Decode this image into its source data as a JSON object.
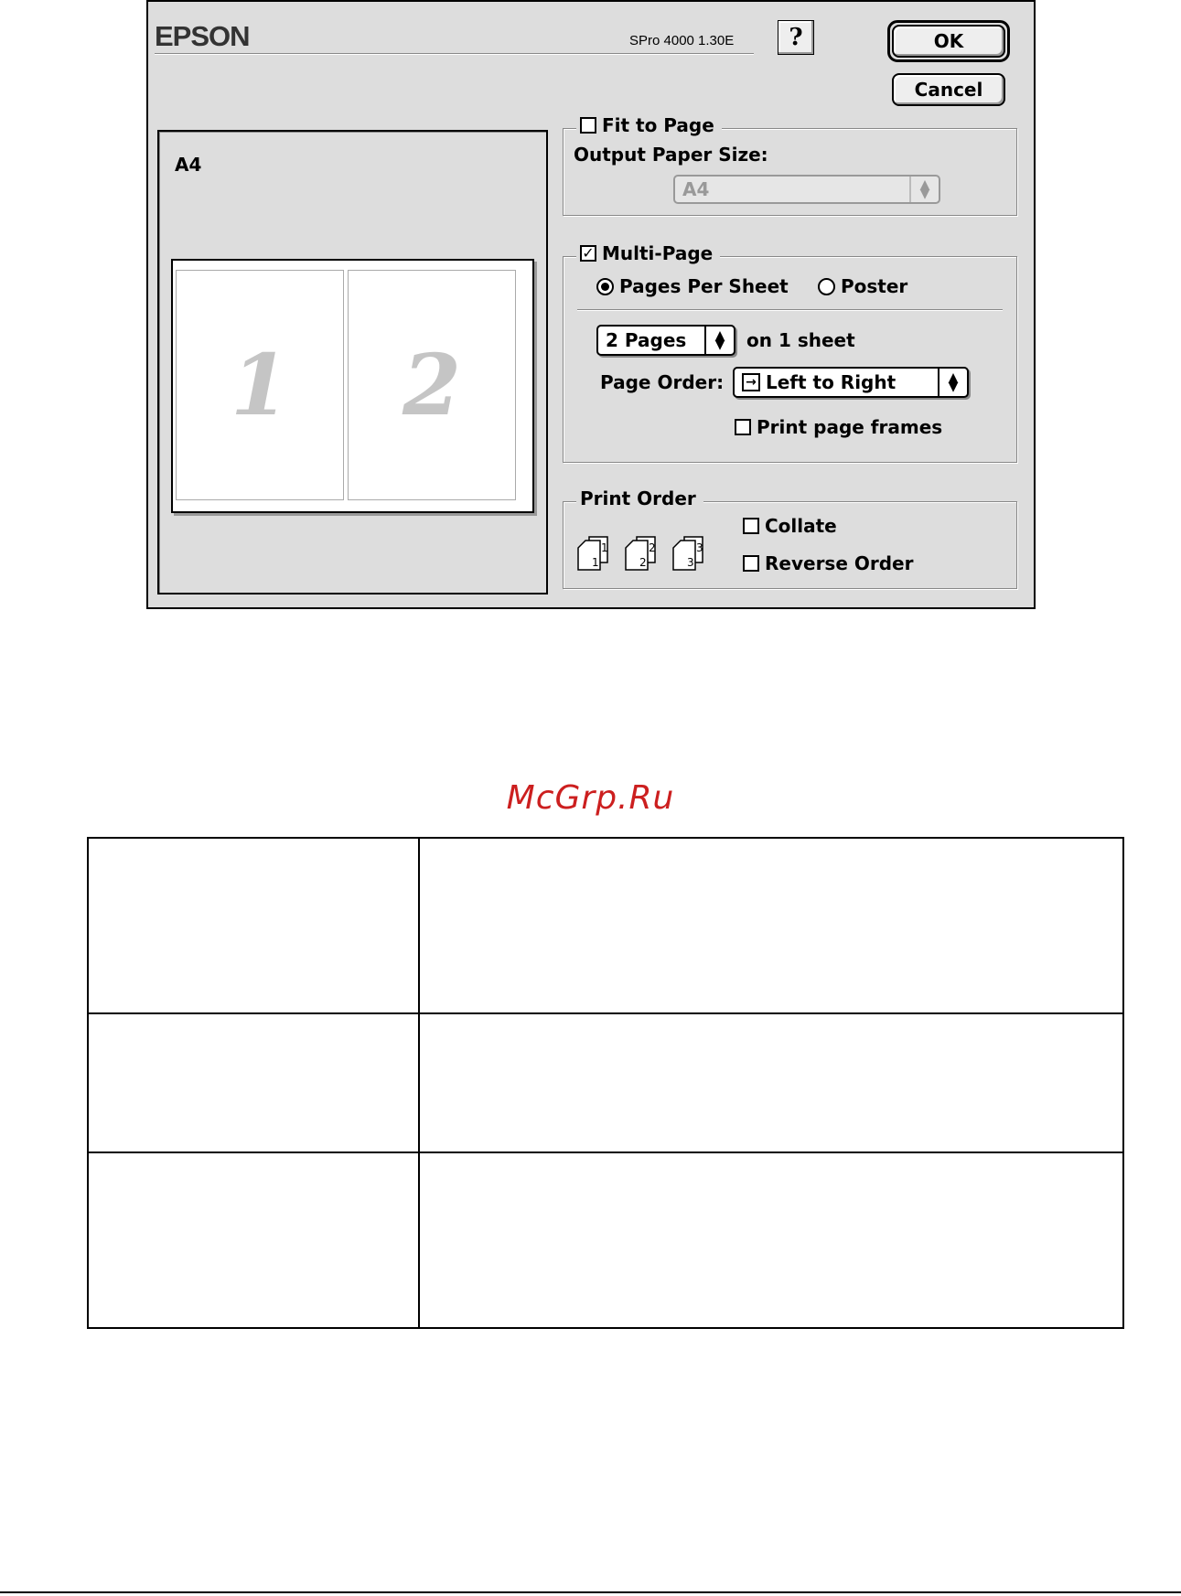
{
  "dialog": {
    "brand": "EPSON",
    "version": "SPro 4000 1.30E",
    "help_label": "?",
    "ok_label": "OK",
    "cancel_label": "Cancel"
  },
  "preview": {
    "paper_size": "A4",
    "pages": [
      "1",
      "2"
    ]
  },
  "fit_to_page": {
    "label": "Fit to Page",
    "checked": false,
    "output_paper_label": "Output Paper Size:",
    "output_paper_value": "A4",
    "output_paper_enabled": false
  },
  "multi_page": {
    "label": "Multi-Page",
    "checked": true,
    "mode_pages_per_sheet": "Pages Per Sheet",
    "mode_poster": "Poster",
    "selected_mode": "Pages Per Sheet",
    "pages_value": "2 Pages",
    "pages_suffix": "on 1 sheet",
    "page_order_label": "Page Order:",
    "page_order_value": "Left to Right",
    "page_order_glyph": "→",
    "print_frames_label": "Print page frames",
    "print_frames_checked": false
  },
  "print_order": {
    "label": "Print Order",
    "collate_label": "Collate",
    "collate_checked": false,
    "reverse_label": "Reverse Order",
    "reverse_checked": false,
    "icon_numbers": [
      "1",
      "2",
      "3"
    ]
  },
  "watermark": "McGrp.Ru",
  "doc_table": {
    "rows": [
      [
        "",
        ""
      ],
      [
        "",
        ""
      ],
      [
        "",
        ""
      ]
    ]
  }
}
